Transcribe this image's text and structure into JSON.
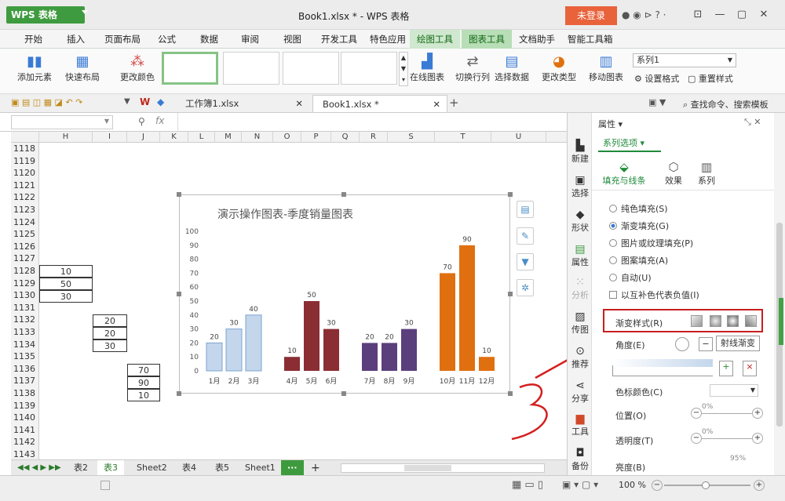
{
  "app": {
    "logo": "WPS 表格",
    "title": "Book1.xlsx * - WPS 表格",
    "login": "未登录"
  },
  "menu": [
    "开始",
    "插入",
    "页面布局",
    "公式",
    "数据",
    "审阅",
    "视图",
    "开发工具",
    "特色应用",
    "绘图工具",
    "图表工具",
    "文档助手",
    "智能工具箱"
  ],
  "ribbon": {
    "add_element": "添加元素",
    "quick_layout": "快速布局",
    "change_color": "更改颜色",
    "online_chart": "在线图表",
    "switch_rowcol": "切换行列",
    "select_data": "选择数据",
    "change_type": "更改类型",
    "move_chart": "移动图表",
    "series_select": "系列1",
    "set_format": "设置格式",
    "reset_style": "重置样式"
  },
  "doc_tabs": [
    "工作簿1.xlsx",
    "Book1.xlsx *"
  ],
  "search": "查找命令、搜索模板",
  "fx": "fx",
  "columns": [
    "H",
    "I",
    "J",
    "K",
    "L",
    "M",
    "N",
    "O",
    "P",
    "Q",
    "R",
    "S",
    "T",
    "U"
  ],
  "rows": [
    "1118",
    "1119",
    "1120",
    "1121",
    "1122",
    "1123",
    "1124",
    "1125",
    "1126",
    "1127",
    "1128",
    "1129",
    "1130",
    "1131",
    "1132",
    "1133",
    "1134",
    "1135",
    "1136",
    "1137",
    "1138",
    "1139",
    "1140",
    "1141",
    "1142",
    "1143"
  ],
  "cells": {
    "h": [
      "10",
      "50",
      "30"
    ],
    "i": [
      "20",
      "20",
      "30"
    ],
    "j": [
      "70",
      "90",
      "10"
    ]
  },
  "chart_data": {
    "type": "bar",
    "title": "演示操作图表-季度销量图表",
    "categories": [
      "1月",
      "2月",
      "3月",
      "4月",
      "5月",
      "6月",
      "7月",
      "8月",
      "9月",
      "10月",
      "11月",
      "12月"
    ],
    "values": [
      20,
      30,
      40,
      10,
      50,
      30,
      20,
      20,
      30,
      70,
      90,
      10
    ],
    "colors": [
      "#c3d6ec",
      "#c3d6ec",
      "#c3d6ec",
      "#8b2e34",
      "#8b2e34",
      "#8b2e34",
      "#5b3f7c",
      "#5b3f7c",
      "#5b3f7c",
      "#e0700f",
      "#e0700f",
      "#e0700f"
    ],
    "ylim": [
      0,
      100
    ],
    "yticks": [
      "0",
      "10",
      "20",
      "30",
      "40",
      "50",
      "60",
      "70",
      "80",
      "90",
      "100"
    ],
    "grid": false
  },
  "sheets": [
    "表2",
    "表3",
    "Sheet2",
    "表4",
    "表5",
    "Sheet1"
  ],
  "active_sheet": "表3",
  "side_strip": [
    "新建",
    "选择",
    "形状",
    "属性",
    "分析",
    "传图",
    "推荐",
    "分享",
    "工具",
    "备份"
  ],
  "panel": {
    "title": "属性",
    "series_opt": "系列选项",
    "tabs": [
      "填充与线条",
      "效果",
      "系列"
    ],
    "fills": [
      "纯色填充(S)",
      "渐变填充(G)",
      "图片或纹理填充(P)",
      "图案填充(A)",
      "自动(U)"
    ],
    "invert": "以互补色代表负值(I)",
    "grad_style": "渐变样式(R)",
    "angle": "角度(E)",
    "tooltip": "射线渐变",
    "stop_color": "色标颜色(C)",
    "position": "位置(O)",
    "transparency": "透明度(T)",
    "brightness": "亮度(B)",
    "pos_val": "0%",
    "trans_val": "0%",
    "bright_val": "95%"
  },
  "zoom": "100 %",
  "annotation": "3"
}
